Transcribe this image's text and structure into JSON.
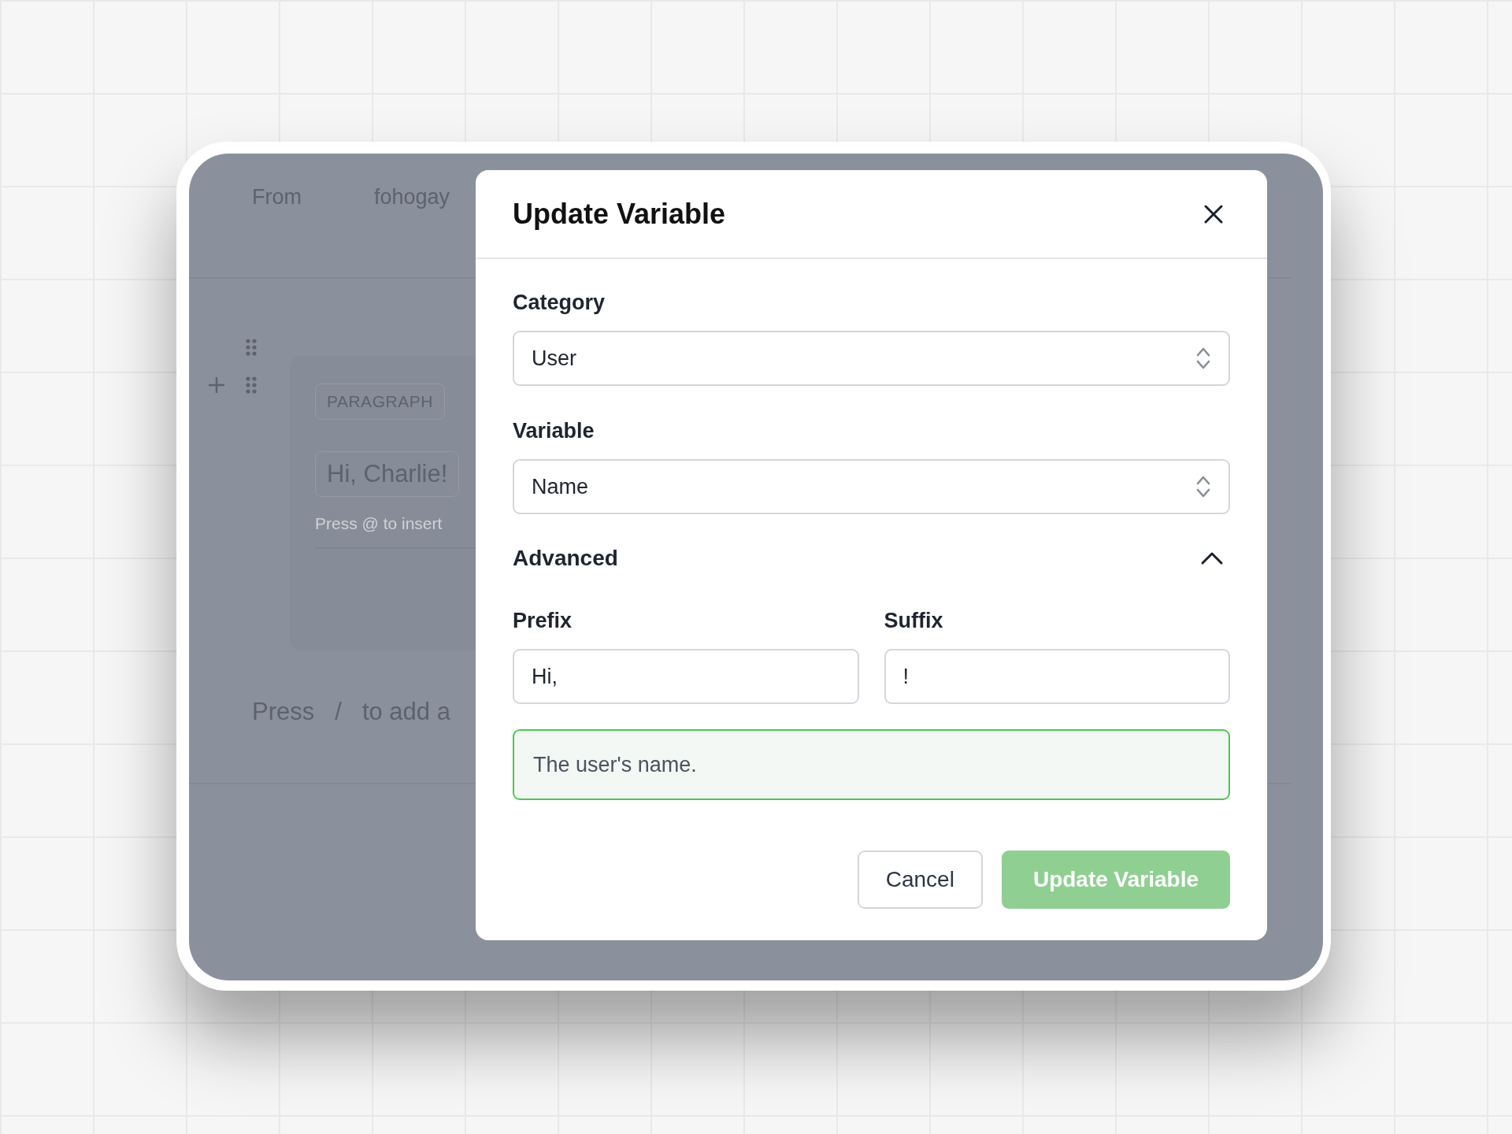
{
  "background": {
    "header": [
      {
        "text": "From"
      },
      {
        "text": "fohogay"
      }
    ],
    "block_type": "PARAGRAPH",
    "chip": "Hi, Charlie!",
    "hint": "Press @ to insert",
    "add_hint": [
      "Press",
      "/",
      "to add a"
    ]
  },
  "dialog": {
    "title": "Update Variable",
    "fields": [
      {
        "label": "Category",
        "value": "User",
        "kind": "select"
      },
      {
        "label": "Variable",
        "value": "Name",
        "kind": "select"
      }
    ],
    "advanced": {
      "label": "Advanced",
      "expanded": true,
      "prefix": {
        "label": "Prefix",
        "value": "Hi,"
      },
      "suffix": {
        "label": "Suffix",
        "value": "!"
      }
    },
    "description": "The user's name.",
    "buttons": [
      {
        "label": "Cancel",
        "kind": "secondary",
        "disabled": false
      },
      {
        "label": "Update Variable",
        "kind": "primary",
        "disabled": true
      }
    ]
  }
}
